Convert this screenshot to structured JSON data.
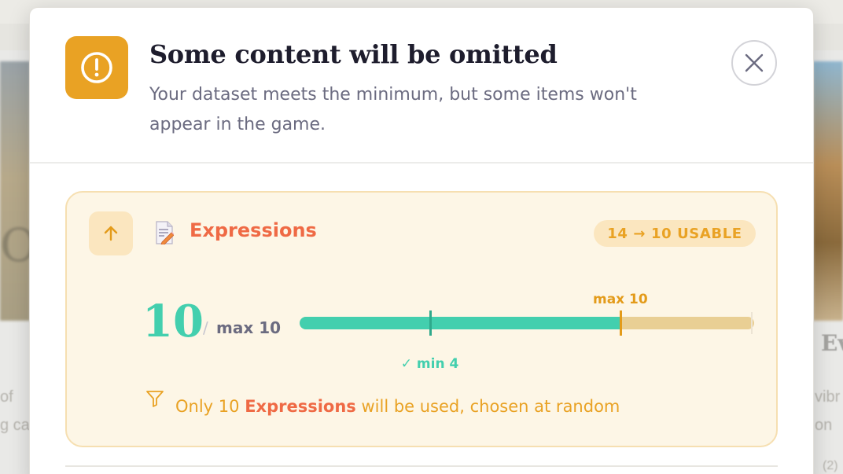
{
  "background": {
    "left_lines": [
      "of",
      "g ca"
    ],
    "right_lines": [
      "vibr",
      "on"
    ],
    "right_heading": "Ev",
    "right_footer": "(2)"
  },
  "modal": {
    "title": "Some content will be omitted",
    "subtitle": "Your dataset meets the minimum, but some items won't appear in the game.",
    "warning_icon": "exclamation-circle-icon",
    "close_icon": "close-icon"
  },
  "item": {
    "sort_icon": "arrow-up-icon",
    "type_icon": "document-pencil-icon",
    "name": "Expressions",
    "usable_badge": "14 → 10 USABLE",
    "count": "10",
    "slash": "/",
    "max_text": "max 10",
    "max_marker_label": "max 10",
    "min_marker_label": "✓ min 4",
    "progress": {
      "current": 10,
      "min": 4,
      "max": 10,
      "scale_max": 14
    },
    "notice": {
      "prefix": "Only 10 ",
      "highlight": "Expressions",
      "suffix": " will be used, chosen at random"
    },
    "filter_icon": "filter-icon"
  },
  "colors": {
    "accent_warning": "#e9a224",
    "accent_teal": "#43cfae",
    "accent_coral": "#ef6a45",
    "card_bg": "#fdf6e6"
  }
}
